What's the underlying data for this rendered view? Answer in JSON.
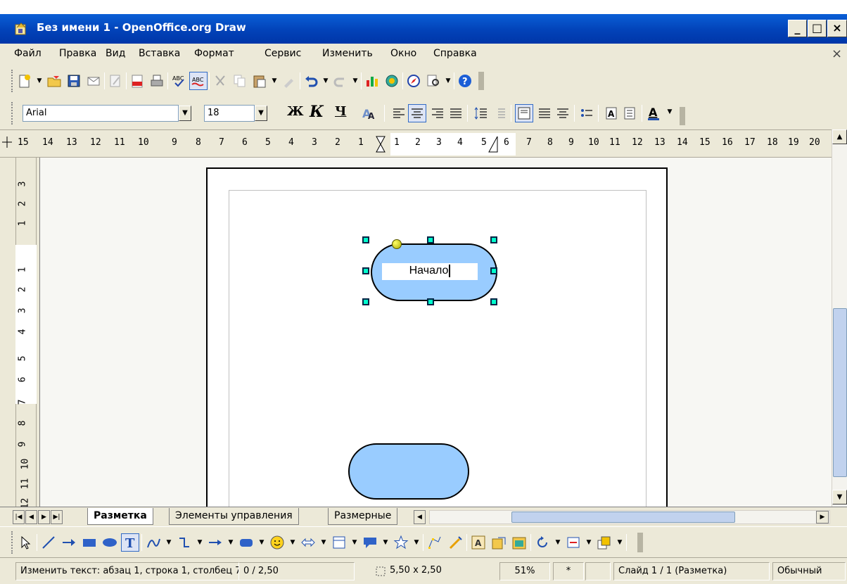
{
  "window": {
    "title": "Без имени 1 - OpenOffice.org Draw",
    "minimize": "_",
    "maximize": "□",
    "close": "×",
    "doc_close": "×"
  },
  "menu": [
    "Файл",
    "Правка",
    "Вид",
    "Вставка",
    "Формат",
    "Сервис",
    "Изменить",
    "Окно",
    "Справка"
  ],
  "format_toolbar": {
    "font_name": "Arial",
    "font_size": "18",
    "bold": "Ж",
    "italic": "К",
    "underline": "Ч"
  },
  "hruler": {
    "left_numbers": [
      "15",
      "14",
      "13",
      "12",
      "11",
      "10",
      "9",
      "8",
      "7",
      "6",
      "5",
      "4",
      "3",
      "2",
      "1"
    ],
    "mid_numbers": [
      "1",
      "2",
      "3",
      "4",
      "5",
      "6"
    ],
    "right_numbers": [
      "7",
      "8",
      "9",
      "10",
      "11",
      "12",
      "13",
      "14",
      "15",
      "16",
      "17",
      "18",
      "19",
      "20",
      "2"
    ]
  },
  "vruler": {
    "numbers": [
      "3",
      "2",
      "1",
      "1",
      "2",
      "3",
      "4",
      "5",
      "6",
      "7",
      "8",
      "9",
      "10",
      "11",
      "12"
    ]
  },
  "canvas": {
    "shape_text": "Начало"
  },
  "tabs": [
    "Разметка",
    "Элементы управления",
    "Размерные"
  ],
  "status": {
    "message": "Изменить текст: абзац 1, строка 1, столбец 7",
    "position": "0 / 2,50",
    "size": "5,50 x 2,50",
    "zoom": "51%",
    "modified": "*",
    "slide": "Слайд 1 / 1 (Разметка)",
    "layout": "Обычный"
  },
  "colors": {
    "title_bar": "#0242b8",
    "shape_fill": "#99ccff",
    "handle": "#00ffcc",
    "background": "#ece9d8"
  }
}
